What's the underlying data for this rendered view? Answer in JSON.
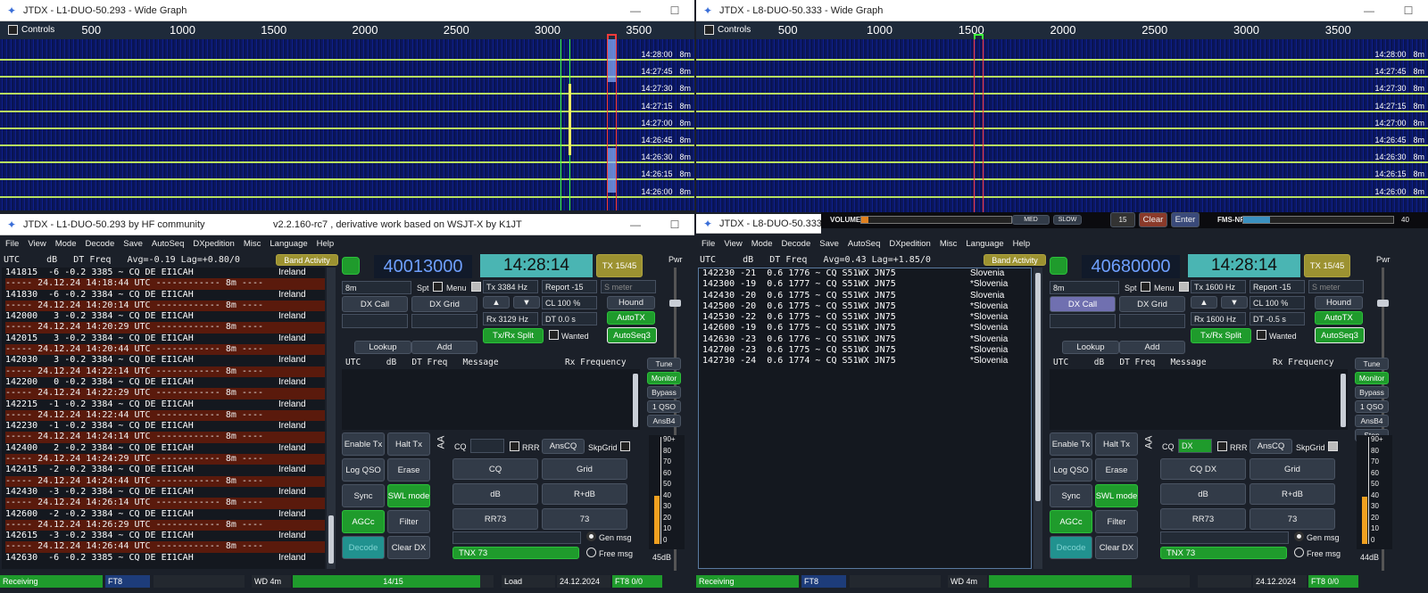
{
  "left_wg": {
    "title": "JTDX - L1-DUO-50.293 - Wide Graph",
    "controls": "Controls",
    "scale": [
      "500",
      "1000",
      "1500",
      "2000",
      "2500",
      "3000",
      "3500"
    ],
    "times": [
      "14:28:00",
      "14:27:45",
      "14:27:30",
      "14:27:15",
      "14:27:00",
      "14:26:45",
      "14:26:30",
      "14:26:15",
      "14:26:00"
    ],
    "band": "8m"
  },
  "right_wg": {
    "title": "JTDX - L8-DUO-50.333 - Wide Graph",
    "controls": "Controls",
    "scale": [
      "500",
      "1000",
      "1500",
      "2000",
      "2500",
      "3000",
      "3500"
    ],
    "times": [
      "14:28:00",
      "14:27:45",
      "14:27:30",
      "14:27:15",
      "14:27:00",
      "14:26:45",
      "14:26:30",
      "14:26:15",
      "14:26:00"
    ],
    "band": "8m",
    "sdr": {
      "volume": "VOLUME",
      "med": "MED",
      "slow": "SLOW",
      "clear": "Clear",
      "enter": "Enter",
      "num": "15",
      "fms": "FMS-NR",
      "fmsval": "40"
    }
  },
  "left_main": {
    "title": "JTDX - L1-DUO-50.293  by HF community",
    "title2": "v2.2.160-rc7 , derivative work based on WSJT-X by K1JT",
    "menu": [
      "File",
      "View",
      "Mode",
      "Decode",
      "Save",
      "AutoSeq",
      "DXpedition",
      "Misc",
      "Language",
      "Help"
    ],
    "header": "UTC     dB   DT Freq   Avg=-0.19 Lag=+0.80/0",
    "band_activity": "Band Activity",
    "lines": [
      {
        "t": "r",
        "text": "141815  -6 -0.2 3385 ~ CQ DE EI1CAH",
        "c": "Ireland"
      },
      {
        "t": "s",
        "text": "----- 24.12.24 14:18:44 UTC ------------ 8m ----"
      },
      {
        "t": "r",
        "text": "141830  -6 -0.2 3384 ~ CQ DE EI1CAH",
        "c": "Ireland"
      },
      {
        "t": "s",
        "text": "----- 24.12.24 14:20:14 UTC ------------ 8m ----"
      },
      {
        "t": "r",
        "text": "142000   3 -0.2 3384 ~ CQ DE EI1CAH",
        "c": "Ireland"
      },
      {
        "t": "s",
        "text": "----- 24.12.24 14:20:29 UTC ------------ 8m ----"
      },
      {
        "t": "r",
        "text": "142015   3 -0.2 3384 ~ CQ DE EI1CAH",
        "c": "Ireland"
      },
      {
        "t": "s",
        "text": "----- 24.12.24 14:20:44 UTC ------------ 8m ----"
      },
      {
        "t": "r",
        "text": "142030   3 -0.2 3384 ~ CQ DE EI1CAH",
        "c": "Ireland"
      },
      {
        "t": "s",
        "text": "----- 24.12.24 14:22:14 UTC ------------ 8m ----"
      },
      {
        "t": "r",
        "text": "142200   0 -0.2 3384 ~ CQ DE EI1CAH",
        "c": "Ireland"
      },
      {
        "t": "s",
        "text": "----- 24.12.24 14:22:29 UTC ------------ 8m ----"
      },
      {
        "t": "r",
        "text": "142215  -1 -0.2 3384 ~ CQ DE EI1CAH",
        "c": "Ireland"
      },
      {
        "t": "s",
        "text": "----- 24.12.24 14:22:44 UTC ------------ 8m ----"
      },
      {
        "t": "r",
        "text": "142230  -1 -0.2 3384 ~ CQ DE EI1CAH",
        "c": "Ireland"
      },
      {
        "t": "s",
        "text": "----- 24.12.24 14:24:14 UTC ------------ 8m ----"
      },
      {
        "t": "r",
        "text": "142400   2 -0.2 3384 ~ CQ DE EI1CAH",
        "c": "Ireland"
      },
      {
        "t": "s",
        "text": "----- 24.12.24 14:24:29 UTC ------------ 8m ----"
      },
      {
        "t": "r",
        "text": "142415  -2 -0.2 3384 ~ CQ DE EI1CAH",
        "c": "Ireland"
      },
      {
        "t": "s",
        "text": "----- 24.12.24 14:24:44 UTC ------------ 8m ----"
      },
      {
        "t": "r",
        "text": "142430  -3 -0.2 3384 ~ CQ DE EI1CAH",
        "c": "Ireland"
      },
      {
        "t": "s",
        "text": "----- 24.12.24 14:26:14 UTC ------------ 8m ----"
      },
      {
        "t": "r",
        "text": "142600  -2 -0.2 3384 ~ CQ DE EI1CAH",
        "c": "Ireland"
      },
      {
        "t": "s",
        "text": "----- 24.12.24 14:26:29 UTC ------------ 8m ----"
      },
      {
        "t": "r",
        "text": "142615  -3 -0.2 3384 ~ CQ DE EI1CAH",
        "c": "Ireland"
      },
      {
        "t": "s",
        "text": "----- 24.12.24 14:26:44 UTC ------------ 8m ----"
      },
      {
        "t": "r",
        "text": "142630  -6 -0.2 3385 ~ CQ DE EI1CAH",
        "c": "Ireland"
      }
    ],
    "freq": "40013000",
    "clock": "14:28:14",
    "tx_period": "TX 15/45",
    "pwr": "Pwr",
    "band": "8m",
    "spt": "Spt",
    "menu_lbl": "Menu",
    "tx_hz": "Tx  3384 Hz",
    "report": "Report -15",
    "smeter": "S meter",
    "rx_hz": "Rx  3129 Hz",
    "cl": "CL  100 %",
    "dt": "DT 0.0 s",
    "dxcall": "DX Call",
    "dxgrid": "DX Grid",
    "hound": "Hound",
    "autotx": "AutoTX",
    "txrxsplit": "Tx/Rx Split",
    "wanted": "Wanted",
    "autoseq": "AutoSeq3",
    "lookup": "Lookup",
    "add": "Add",
    "rx_header": "UTC     dB   DT Freq   Message             Rx Frequency",
    "side": [
      "Tune",
      "Monitor",
      "Bypass",
      "1 QSO",
      "AnsB4"
    ],
    "enable_tx": "Enable Tx",
    "halt_tx": "Halt Tx",
    "log_qso": "Log QSO",
    "erase": "Erase",
    "sync": "Sync",
    "swl": "SWL mode",
    "agcc": "AGCc",
    "filter": "Filter",
    "decode": "Decode",
    "clear_dx": "Clear DX",
    "cq": "CQ",
    "cq_val": "",
    "rrr": "RRR",
    "anscq": "AnsCQ",
    "skpgrid": "SkpGrid",
    "macros": [
      "CQ",
      "Grid",
      "dB",
      "R+dB",
      "RR73",
      "73"
    ],
    "gen": "Gen msg",
    "free": "Free msg",
    "free_val": "TNX 73",
    "meter_scale": [
      "90+",
      "80",
      "70",
      "60",
      "50",
      "40",
      "30",
      "20",
      "10",
      "0"
    ],
    "meter_db": "45dB",
    "meter_level": 0.45,
    "status": {
      "receiving": "Receiving",
      "ft8": "FT8",
      "wd": "WD 4m",
      "prog": "14/15",
      "load": "Load",
      "date": "24.12.2024",
      "ft8b": "FT8  0/0"
    }
  },
  "right_main": {
    "title": "JTDX - L8-DUO-50.333  by H",
    "menu": [
      "File",
      "View",
      "Mode",
      "Decode",
      "Save",
      "AutoSeq",
      "DXpedition",
      "Misc",
      "Language",
      "Help"
    ],
    "header": "UTC     dB   DT Freq   Avg=0.43 Lag=+1.85/0",
    "band_activity": "Band Activity",
    "lines": [
      {
        "t": "r",
        "text": "142230 -21  0.6 1776 ~ CQ S51WX JN75",
        "c": "Slovenia"
      },
      {
        "t": "r",
        "text": "142300 -19  0.6 1777 ~ CQ S51WX JN75",
        "c": "*Slovenia"
      },
      {
        "t": "r",
        "text": "142430 -20  0.6 1775 ~ CQ S51WX JN75",
        "c": "Slovenia"
      },
      {
        "t": "r",
        "text": "142500 -20  0.6 1775 ~ CQ S51WX JN75",
        "c": "*Slovenia"
      },
      {
        "t": "r",
        "text": "142530 -22  0.6 1775 ~ CQ S51WX JN75",
        "c": "*Slovenia"
      },
      {
        "t": "r",
        "text": "142600 -19  0.6 1775 ~ CQ S51WX JN75",
        "c": "*Slovenia"
      },
      {
        "t": "r",
        "text": "142630 -23  0.6 1776 ~ CQ S51WX JN75",
        "c": "*Slovenia"
      },
      {
        "t": "r",
        "text": "142700 -23  0.6 1775 ~ CQ S51WX JN75",
        "c": "*Slovenia"
      },
      {
        "t": "r",
        "text": "142730 -24  0.6 1774 ~ CQ S51WX JN75",
        "c": "*Slovenia"
      }
    ],
    "freq": "40680000",
    "clock": "14:28:14",
    "tx_period": "TX 15/45",
    "pwr": "Pwr",
    "band": "8m",
    "spt": "Spt",
    "menu_lbl": "Menu",
    "tx_hz": "Tx  1600 Hz",
    "report": "Report -15",
    "smeter": "S meter",
    "rx_hz": "Rx  1600 Hz",
    "cl": "CL  100 %",
    "dt": "DT  -0.5 s",
    "dxcall": "DX Call",
    "dxgrid": "DX Grid",
    "hound": "Hound",
    "autotx": "AutoTX",
    "txrxsplit": "Tx/Rx Split",
    "wanted": "Wanted",
    "autoseq": "AutoSeq3",
    "lookup": "Lookup",
    "add": "Add",
    "rx_header": "UTC     dB   DT Freq   Message             Rx Frequency",
    "side": [
      "Tune",
      "Monitor",
      "Bypass",
      "1 QSO",
      "AnsB4",
      "Stop"
    ],
    "enable_tx": "Enable Tx",
    "halt_tx": "Halt Tx",
    "log_qso": "Log QSO",
    "erase": "Erase",
    "sync": "Sync",
    "swl": "SWL mode",
    "agcc": "AGCc",
    "filter": "Filter",
    "decode": "Decode",
    "clear_dx": "Clear DX",
    "cq": "CQ",
    "cq_val": "DX",
    "rrr": "RRR",
    "anscq": "AnsCQ",
    "skpgrid": "SkpGrid",
    "macros": [
      "CQ DX",
      "Grid",
      "dB",
      "R+dB",
      "RR73",
      "73"
    ],
    "gen": "Gen msg",
    "free": "Free msg",
    "free_val": "TNX 73",
    "meter_scale": [
      "90+",
      "80",
      "70",
      "60",
      "50",
      "40",
      "30",
      "20",
      "10",
      "0"
    ],
    "meter_db": "44dB",
    "meter_level": 0.44,
    "status": {
      "receiving": "Receiving",
      "ft8": "FT8",
      "wd": "WD 4m",
      "prog": "",
      "load": "",
      "date": "24.12.2024",
      "ft8b": "FT8  0/0"
    }
  },
  "colors": {
    "accent_green": "#1f9b2c",
    "olive": "#9c9231",
    "teal": "#4ab5b3",
    "separator": "#5a1a0c",
    "waterfall": "#0e1f8a",
    "freq_text": "#6fa0ff"
  }
}
